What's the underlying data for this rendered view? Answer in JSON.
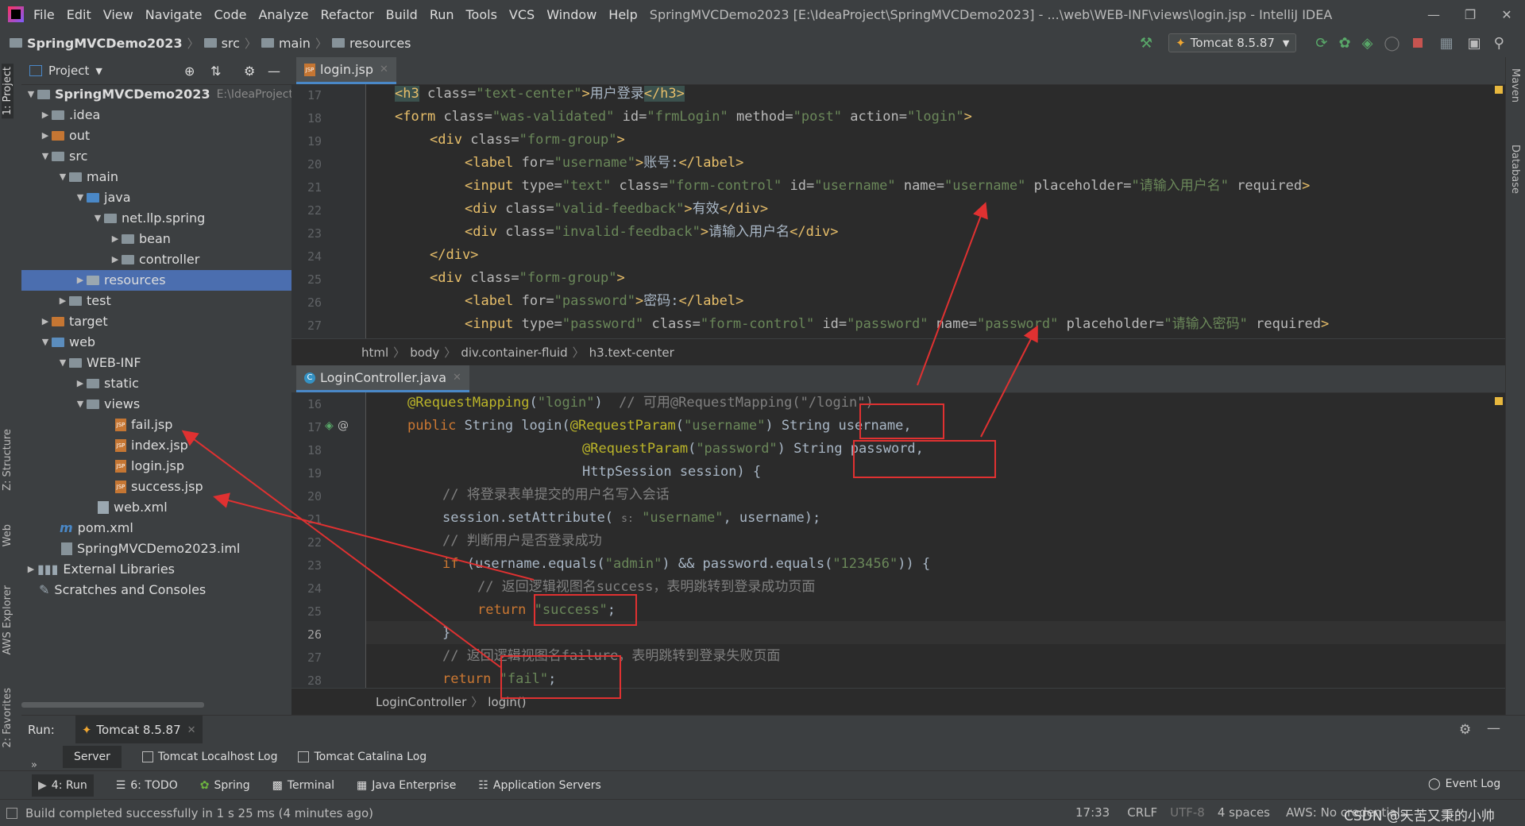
{
  "titlebar": {
    "menu": [
      "File",
      "Edit",
      "View",
      "Navigate",
      "Code",
      "Analyze",
      "Refactor",
      "Build",
      "Run",
      "Tools",
      "VCS",
      "Window",
      "Help"
    ],
    "title": "SpringMVCDemo2023 [E:\\IdeaProject\\SpringMVCDemo2023] - ...\\web\\WEB-INF\\views\\login.jsp - IntelliJ IDEA"
  },
  "navbar": {
    "crumbs": [
      "SpringMVCDemo2023",
      "src",
      "main",
      "resources"
    ],
    "run_config": "Tomcat 8.5.87"
  },
  "left_strip": [
    "1: Project",
    "Z: Structure",
    "Web",
    "AWS Explorer",
    "2: Favorites"
  ],
  "right_strip": [
    "Maven",
    "Database"
  ],
  "project": {
    "title": "Project",
    "root_name": "SpringMVCDemo2023",
    "root_path": "E:\\IdeaProject\\S",
    "items": [
      ".idea",
      "out",
      "src",
      "main",
      "java",
      "net.llp.spring",
      "bean",
      "controller",
      "resources",
      "test",
      "target",
      "web",
      "WEB-INF",
      "static",
      "views",
      "fail.jsp",
      "index.jsp",
      "login.jsp",
      "success.jsp",
      "web.xml",
      "pom.xml",
      "SpringMVCDemo2023.iml",
      "External Libraries",
      "Scratches and Consoles"
    ]
  },
  "editor1": {
    "tab": "login.jsp",
    "line_numbers": [
      "17",
      "18",
      "19",
      "20",
      "21",
      "22",
      "23",
      "24",
      "25",
      "26",
      "27"
    ],
    "breadcrumbs": [
      "html",
      "body",
      "div.container-fluid",
      "h3.text-center"
    ]
  },
  "editor2": {
    "tab": "LoginController.java",
    "line_numbers": [
      "16",
      "17",
      "18",
      "19",
      "20",
      "21",
      "22",
      "23",
      "24",
      "25",
      "26",
      "27",
      "28"
    ],
    "breadcrumbs": [
      "LoginController",
      "login()"
    ]
  },
  "run": {
    "label": "Run:",
    "config": "Tomcat 8.5.87",
    "tabs": [
      "Server",
      "Tomcat Localhost Log",
      "Tomcat Catalina Log"
    ]
  },
  "toolwindows": [
    "4: Run",
    "6: TODO",
    "Spring",
    "Terminal",
    "Java Enterprise",
    "Application Servers"
  ],
  "event_log": "Event Log",
  "status": {
    "message": "Build completed successfully in 1 s 25 ms (4 minutes ago)",
    "position": "17:33",
    "line_sep": "CRLF",
    "encoding": "UTF-8",
    "indent": "4 spaces",
    "aws": "AWS: No credentials",
    "watermark": "CSDN @天苦又秉的小帅"
  }
}
